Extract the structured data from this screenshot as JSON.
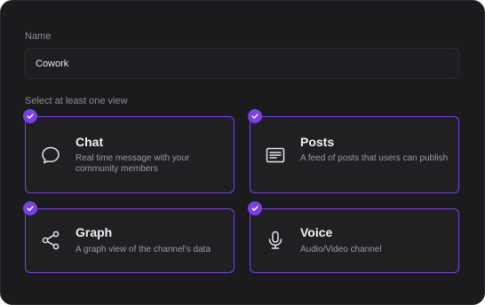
{
  "form": {
    "name_label": "Name",
    "name_value": "Cowork",
    "views_label": "Select at least one view"
  },
  "views": [
    {
      "title": "Chat",
      "description": "Real time message with your community members",
      "icon": "chat-bubble-icon",
      "selected": true
    },
    {
      "title": "Posts",
      "description": "A feed of posts that users can publish",
      "icon": "feed-icon",
      "selected": true
    },
    {
      "title": "Graph",
      "description": "A graph view of the channel's data",
      "icon": "share-graph-icon",
      "selected": true
    },
    {
      "title": "Voice",
      "description": "Audio/Video channel",
      "icon": "microphone-icon",
      "selected": true
    }
  ],
  "colors": {
    "accent": "#7b3fe8",
    "panel_background": "#1b1b1d",
    "card_background": "#202023"
  }
}
